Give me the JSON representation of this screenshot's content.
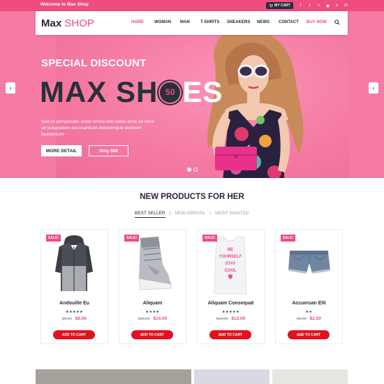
{
  "topbar": {
    "welcome": "Welcome to Max Shop",
    "cart_label": "MY CART",
    "social_icons": [
      "facebook-icon",
      "twitter-icon",
      "vimeo-icon",
      "rss-icon",
      "skype-icon",
      "linkedin-icon"
    ],
    "social_glyphs": [
      "f",
      "t",
      "v",
      "◉",
      "s",
      "in"
    ]
  },
  "navbar": {
    "logo_main": "Max",
    "logo_accent": "SHOP",
    "items": [
      "HOME",
      "WOMAN",
      "MAN",
      "T-SHIRTS",
      "SNEAKERS",
      "NEWS",
      "CONTACT",
      "BUY NOW"
    ]
  },
  "hero": {
    "subtitle": "SPECIAL DISCOUNT",
    "heading_left": "MAX SH",
    "badge": "50",
    "heading_right": "ES",
    "text": "Sed ut perspiciatis unde omnis iste natus error sit error sit voluptatem accusantium doloremque dolorem laudantium",
    "button_detail": "MORE DETAIL",
    "button_price": "Only $99",
    "prev_arrow": "‹",
    "next_arrow": "›"
  },
  "products": {
    "title": "NEW PRODUCTS FOR HER",
    "tabs": [
      "BEST SELLER",
      "NEW ARRIVAL",
      "MOST WANTED"
    ],
    "tab_separator": "|",
    "sale_label": "SALE!",
    "cart_label": "ADD TO CART",
    "items": [
      {
        "name": "Andouille Eu",
        "stars": "★★★★★",
        "old_price": "$9.00",
        "price": "$8.00"
      },
      {
        "name": "Aliquam",
        "stars": "★★★★",
        "old_price": "$15.00",
        "price": "$14.00"
      },
      {
        "name": "Aliquam Consequat",
        "stars": "★★★★★",
        "old_price": "$20.00",
        "price": "$12.00"
      },
      {
        "name": "Accumsan Elit",
        "stars": "★★",
        "old_price": "$3.00",
        "price": "$2.00"
      }
    ],
    "tank_print": [
      "BE",
      "YOURSELF",
      "STAY",
      "COOL"
    ]
  },
  "colors": {
    "brand_pink": "#ef4d7e",
    "hero_pink": "#f57ba3",
    "dark": "#2b2f3a",
    "cart_red": "#e3101f"
  }
}
